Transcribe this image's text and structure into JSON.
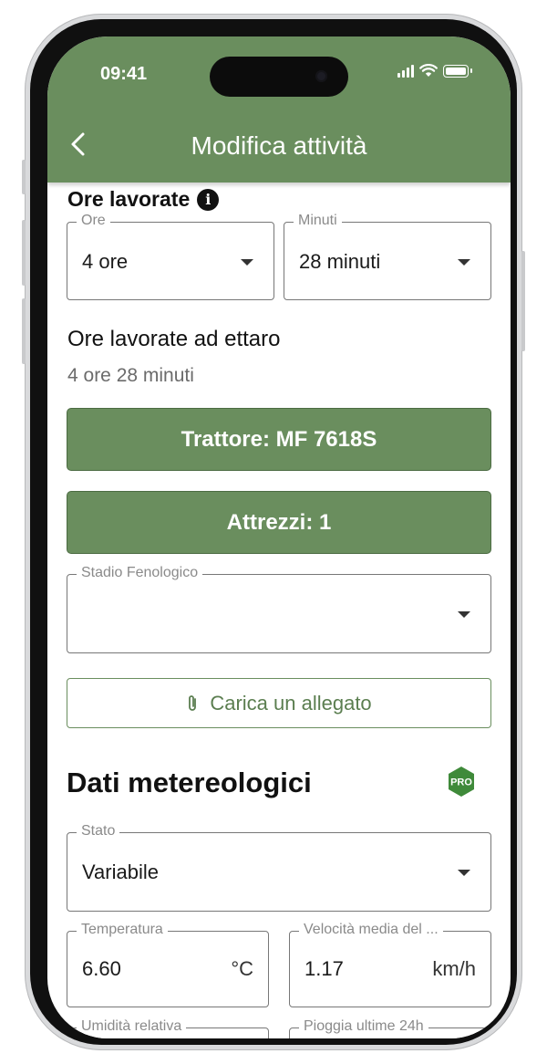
{
  "status_bar": {
    "time": "09:41"
  },
  "header": {
    "title": "Modifica attività"
  },
  "ore_lavorate": {
    "heading": "Ore lavorate",
    "ore": {
      "label": "Ore",
      "value": "4 ore"
    },
    "minuti": {
      "label": "Minuti",
      "value": "28 minuti"
    }
  },
  "ettaro": {
    "heading": "Ore lavorate ad ettaro",
    "value": "4 ore 28 minuti"
  },
  "buttons": {
    "trattore": "Trattore: MF 7618S",
    "attrezzi": "Attrezzi: 1",
    "allegato": "Carica un allegato"
  },
  "stadio": {
    "label": "Stadio Fenologico",
    "value": ""
  },
  "meteo": {
    "heading": "Dati metereologici",
    "badge": "PRO",
    "stato": {
      "label": "Stato",
      "value": "Variabile"
    },
    "temperatura": {
      "label": "Temperatura",
      "value": "6.60",
      "unit": "°C"
    },
    "velocita": {
      "label": "Velocità media del ...",
      "value": "1.17",
      "unit": "km/h"
    },
    "umidita": {
      "label": "Umidità relativa"
    },
    "pioggia": {
      "label": "Pioggia ultime 24h"
    }
  },
  "colors": {
    "brand_green": "#6a8e5e",
    "badge_green": "#3f8a3a"
  }
}
